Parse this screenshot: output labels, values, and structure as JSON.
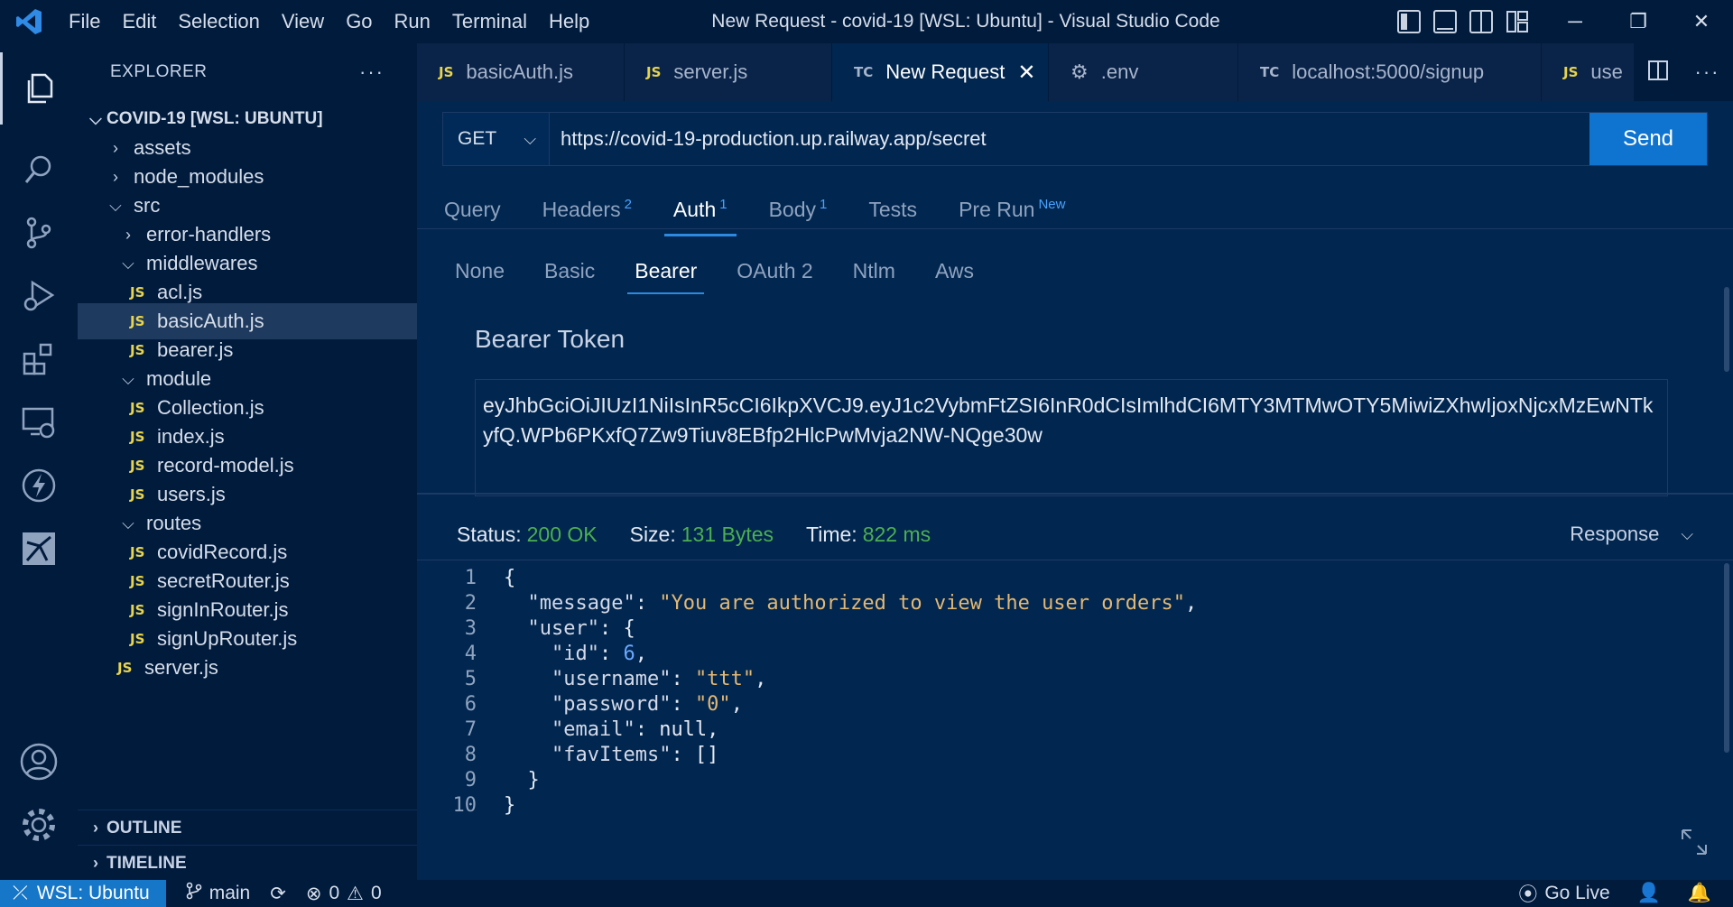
{
  "window": {
    "title": "New Request - covid-19 [WSL: Ubuntu] - Visual Studio Code",
    "menu": [
      "File",
      "Edit",
      "Selection",
      "View",
      "Go",
      "Run",
      "Terminal",
      "Help"
    ]
  },
  "sidebar": {
    "header": "EXPLORER",
    "more": "···",
    "root": "COVID-19 [WSL: UBUNTU]",
    "items": [
      {
        "label": "assets",
        "kind": "folder",
        "open": false
      },
      {
        "label": "node_modules",
        "kind": "folder",
        "open": false
      },
      {
        "label": "src",
        "kind": "folder",
        "open": true
      },
      {
        "label": "error-handlers",
        "kind": "folder",
        "open": false
      },
      {
        "label": "middlewares",
        "kind": "folder",
        "open": true
      },
      {
        "label": "acl.js",
        "kind": "file"
      },
      {
        "label": "basicAuth.js",
        "kind": "file"
      },
      {
        "label": "bearer.js",
        "kind": "file"
      },
      {
        "label": "module",
        "kind": "folder",
        "open": true
      },
      {
        "label": "Collection.js",
        "kind": "file"
      },
      {
        "label": "index.js",
        "kind": "file"
      },
      {
        "label": "record-model.js",
        "kind": "file"
      },
      {
        "label": "users.js",
        "kind": "file"
      },
      {
        "label": "routes",
        "kind": "folder",
        "open": true
      },
      {
        "label": "covidRecord.js",
        "kind": "file"
      },
      {
        "label": "secretRouter.js",
        "kind": "file"
      },
      {
        "label": "signInRouter.js",
        "kind": "file"
      },
      {
        "label": "signUpRouter.js",
        "kind": "file"
      },
      {
        "label": "server.js",
        "kind": "file"
      }
    ],
    "js_badge": "JS",
    "outline": "OUTLINE",
    "timeline": "TIMELINE"
  },
  "tabs": [
    {
      "badge": "JS",
      "label": "basicAuth.js"
    },
    {
      "badge": "JS",
      "label": "server.js"
    },
    {
      "badge": "TC",
      "label": "New Request"
    },
    {
      "badge": "gear",
      "label": ".env"
    },
    {
      "badge": "TC",
      "label": "localhost:5000/signup"
    },
    {
      "badge": "JS",
      "label": "use"
    }
  ],
  "request": {
    "method": "GET",
    "url": "https://covid-19-production.up.railway.app/secret",
    "send": "Send",
    "tabs": [
      {
        "label": "Query",
        "sup": ""
      },
      {
        "label": "Headers",
        "sup": "2"
      },
      {
        "label": "Auth",
        "sup": "1"
      },
      {
        "label": "Body",
        "sup": "1"
      },
      {
        "label": "Tests",
        "sup": ""
      },
      {
        "label": "Pre Run",
        "sup": "New"
      }
    ],
    "auth_tabs": [
      "None",
      "Basic",
      "Bearer",
      "OAuth 2",
      "Ntlm",
      "Aws"
    ],
    "bearer_label": "Bearer Token",
    "token": "eyJhbGciOiJIUzI1NiIsInR5cCI6IkpXVCJ9.eyJ1c2VybmFtZSI6InR0dCIsImlhdCI6MTY3MTMwOTY5MiwiZXhwIjoxNjcxMzEwNTkyfQ.WPb6PKxfQ7Zw9Tiuv8EBfp2HlcPwMvja2NW-NQge30w"
  },
  "response": {
    "status_label": "Status:",
    "status": "200 OK",
    "size_label": "Size:",
    "size": "131 Bytes",
    "time_label": "Time:",
    "time": "822 ms",
    "view": "Response",
    "line_numbers": [
      "1",
      "2",
      "3",
      "4",
      "5",
      "6",
      "7",
      "8",
      "9",
      "10"
    ]
  },
  "statusbar": {
    "remote": "WSL: Ubuntu",
    "branch": "main",
    "errors": "0",
    "warnings": "0",
    "golive": "Go Live"
  },
  "colors": {
    "background": "#011b3d",
    "editor": "#01264f",
    "accent": "#0f74d0",
    "status_ok": "#4caf50",
    "string": "#e3b874",
    "number": "#6aa8ff"
  }
}
